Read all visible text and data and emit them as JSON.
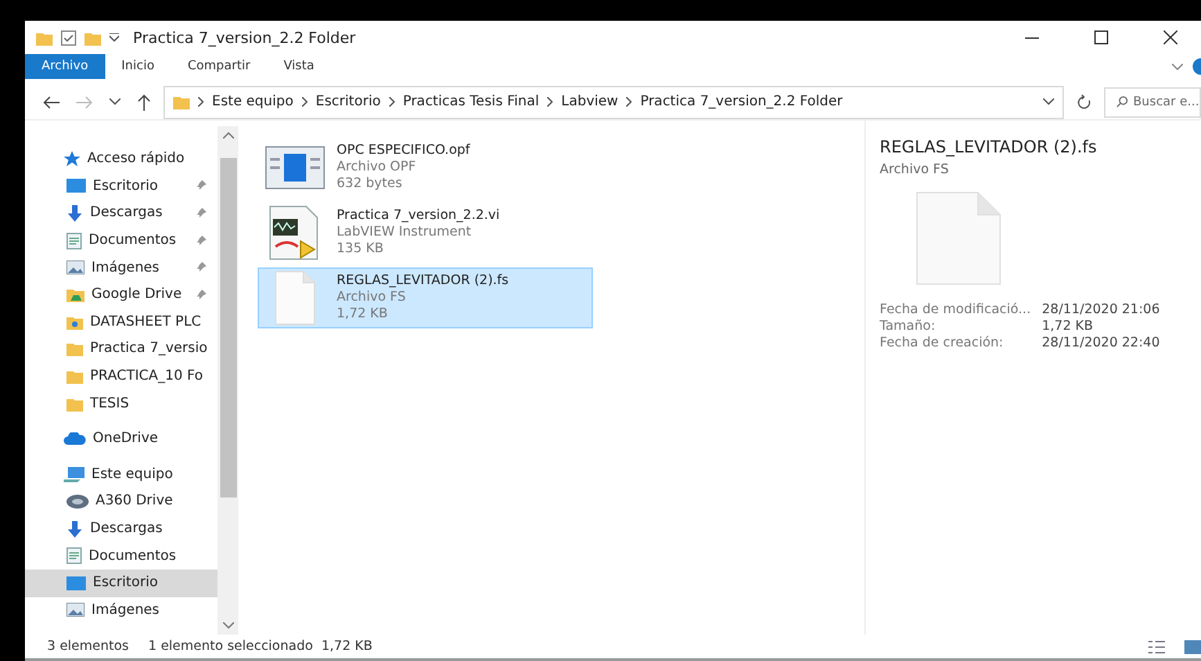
{
  "window": {
    "title": "Practica 7_version_2.2 Folder"
  },
  "ribbon_tabs": [
    {
      "label": "Archivo",
      "selected": true
    },
    {
      "label": "Inicio",
      "selected": false
    },
    {
      "label": "Compartir",
      "selected": false
    },
    {
      "label": "Vista",
      "selected": false
    }
  ],
  "address": {
    "path": [
      "Este equipo",
      "Escritorio",
      "Practicas Tesis Final",
      "Labview",
      "Practica 7_version_2.2 Folder"
    ],
    "search_placeholder": "Buscar e..."
  },
  "sidebar": {
    "sections": [
      {
        "label": "Acceso rápido",
        "kind": "star",
        "selected": false,
        "children": [
          {
            "label": "Escritorio",
            "kind": "desktop",
            "pinned": true,
            "selected": false
          },
          {
            "label": "Descargas",
            "kind": "download",
            "pinned": true,
            "selected": false
          },
          {
            "label": "Documentos",
            "kind": "docs",
            "pinned": true,
            "selected": false
          },
          {
            "label": "Imágenes",
            "kind": "images",
            "pinned": true,
            "selected": false
          },
          {
            "label": "Google Drive",
            "kind": "gdrive",
            "pinned": true,
            "selected": false
          },
          {
            "label": "DATASHEET PLC",
            "kind": "folder-person",
            "pinned": false,
            "selected": false
          },
          {
            "label": "Practica 7_versio",
            "kind": "folder",
            "pinned": false,
            "selected": false
          },
          {
            "label": "PRACTICA_10 Fo",
            "kind": "folder",
            "pinned": false,
            "selected": false
          },
          {
            "label": "TESIS",
            "kind": "folder",
            "pinned": false,
            "selected": false
          }
        ]
      },
      {
        "label": "OneDrive",
        "kind": "cloud",
        "selected": false
      },
      {
        "label": "Este equipo",
        "kind": "pc",
        "selected": false,
        "children": [
          {
            "label": "A360 Drive",
            "kind": "drive",
            "pinned": false,
            "selected": false
          },
          {
            "label": "Descargas",
            "kind": "download",
            "pinned": false,
            "selected": false
          },
          {
            "label": "Documentos",
            "kind": "docs",
            "pinned": false,
            "selected": false
          },
          {
            "label": "Escritorio",
            "kind": "desktop",
            "pinned": false,
            "selected": true
          },
          {
            "label": "Imágenes",
            "kind": "images",
            "pinned": false,
            "selected": false
          }
        ]
      }
    ]
  },
  "files": [
    {
      "name": "OPC ESPECIFICO.opf",
      "type": "Archivo OPF",
      "size": "632 bytes",
      "kind": "opf",
      "selected": false
    },
    {
      "name": "Practica 7_version_2.2.vi",
      "type": "LabVIEW Instrument",
      "size": "135 KB",
      "kind": "vi",
      "selected": false
    },
    {
      "name": "REGLAS_LEVITADOR (2).fs",
      "type": "Archivo FS",
      "size": "1,72 KB",
      "kind": "blank",
      "selected": true
    }
  ],
  "details": {
    "name": "REGLAS_LEVITADOR (2).fs",
    "type": "Archivo FS",
    "properties": [
      {
        "label": "Fecha de modificació...",
        "value": "28/11/2020 21:06"
      },
      {
        "label": "Tamaño:",
        "value": "1,72 KB"
      },
      {
        "label": "Fecha de creación:",
        "value": "28/11/2020 22:40"
      }
    ]
  },
  "status_bar": {
    "count": "3 elementos",
    "selection": "1 elemento seleccionado  1,72 KB"
  }
}
